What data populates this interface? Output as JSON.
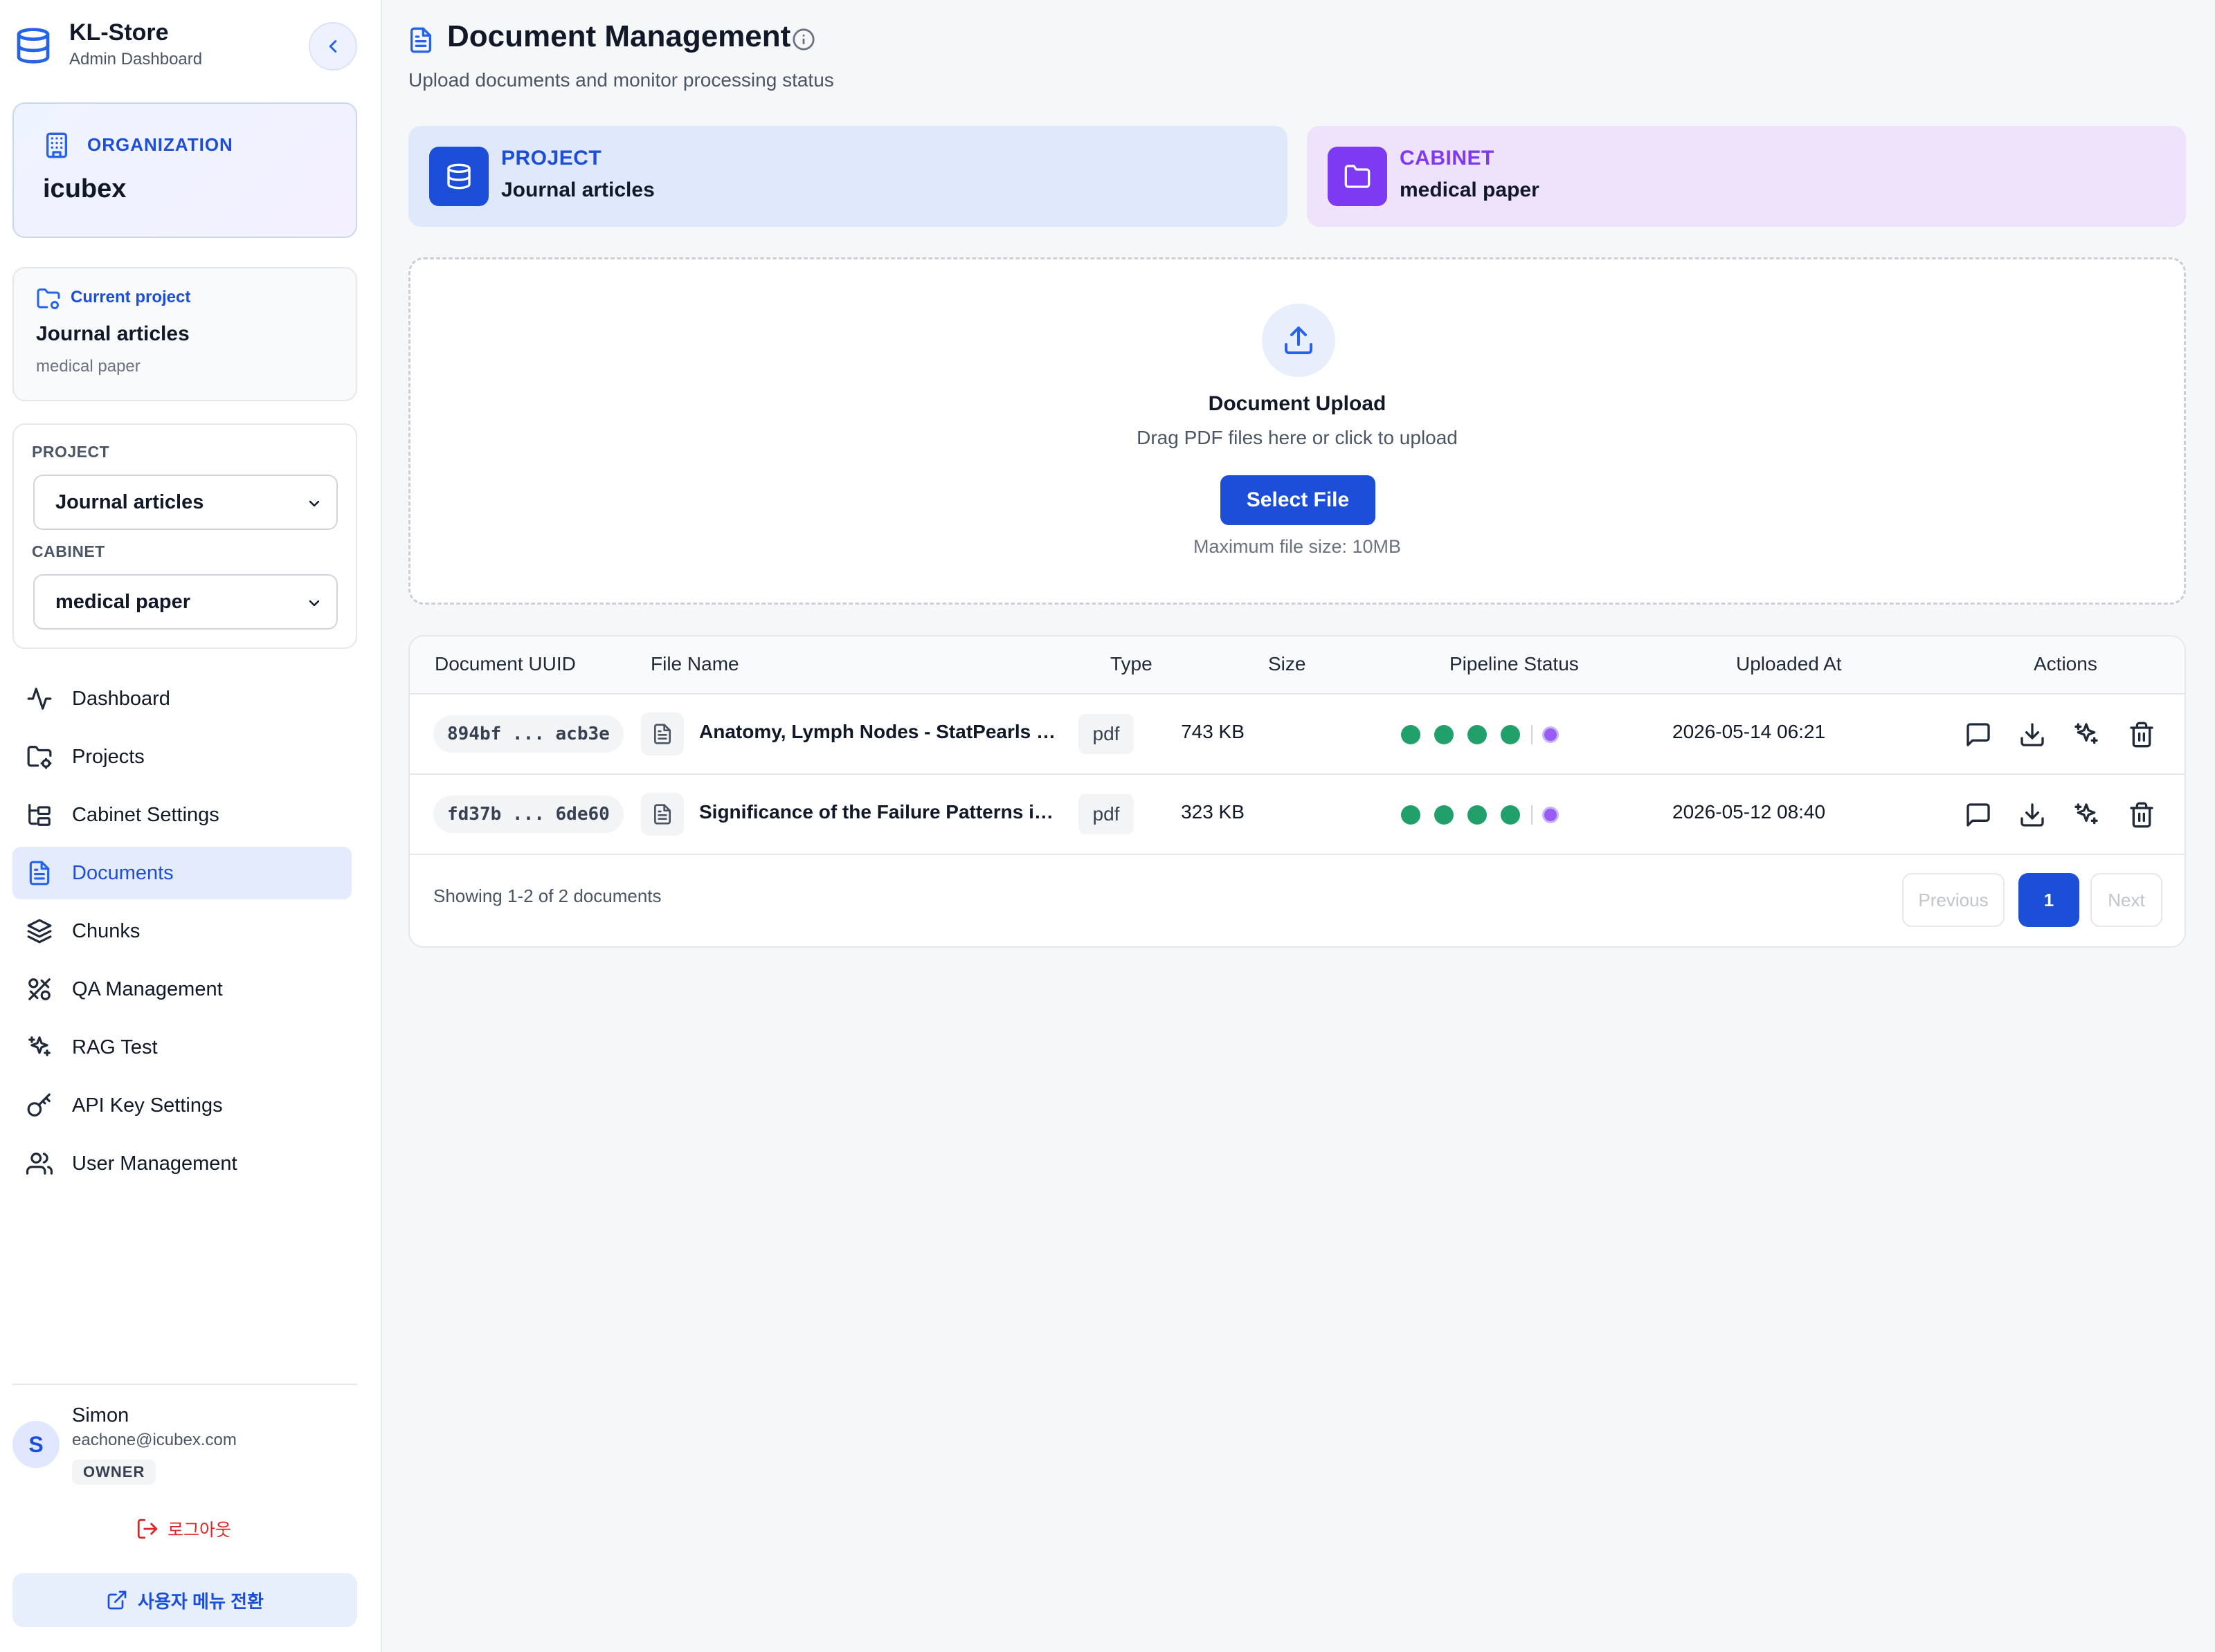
{
  "brand": {
    "name": "KL-Store",
    "subtitle": "Admin Dashboard"
  },
  "organization": {
    "label": "ORGANIZATION",
    "name": "icubex"
  },
  "current_project": {
    "label": "Current project",
    "name": "Journal articles",
    "cabinet": "medical paper"
  },
  "selectors": {
    "project_label": "PROJECT",
    "project_value": "Journal articles",
    "cabinet_label": "CABINET",
    "cabinet_value": "medical paper"
  },
  "nav": [
    {
      "label": "Dashboard",
      "icon": "activity-icon",
      "active": false
    },
    {
      "label": "Projects",
      "icon": "folder-settings-icon",
      "active": false
    },
    {
      "label": "Cabinet Settings",
      "icon": "folder-tree-icon",
      "active": false
    },
    {
      "label": "Documents",
      "icon": "file-text-icon",
      "active": true
    },
    {
      "label": "Chunks",
      "icon": "layers-icon",
      "active": false
    },
    {
      "label": "QA Management",
      "icon": "tools-icon",
      "active": false
    },
    {
      "label": "RAG Test",
      "icon": "sparkles-icon",
      "active": false
    },
    {
      "label": "API Key Settings",
      "icon": "key-icon",
      "active": false
    },
    {
      "label": "User Management",
      "icon": "users-icon",
      "active": false
    }
  ],
  "user": {
    "initial": "S",
    "name": "Simon",
    "email": "eachone@icubex.com",
    "role": "OWNER"
  },
  "logout_label": "로그아웃",
  "switch_menu_label": "사용자 메뉴 전환",
  "page": {
    "title": "Document Management",
    "subtitle": "Upload documents and monitor processing status"
  },
  "context": {
    "project_label": "PROJECT",
    "project_value": "Journal articles",
    "cabinet_label": "CABINET",
    "cabinet_value": "medical paper"
  },
  "upload": {
    "title": "Document Upload",
    "hint": "Drag PDF files here or click to upload",
    "button": "Select File",
    "max_size": "Maximum file size: 10MB"
  },
  "table": {
    "headers": {
      "uuid": "Document UUID",
      "file_name": "File Name",
      "type": "Type",
      "size": "Size",
      "pipeline": "Pipeline Status",
      "uploaded": "Uploaded At",
      "actions": "Actions"
    },
    "rows": [
      {
        "uuid": "894bf ... acb3e",
        "file_name": "Anatomy, Lymph Nodes - StatPearls - NCBI Bookshelf",
        "type": "pdf",
        "size": "743 KB",
        "pipeline_completed_steps": 4,
        "uploaded_at": "2026-05-14 06:21"
      },
      {
        "uuid": "fd37b ... 6de60",
        "file_name": "Significance of the Failure Patterns in Lymph Node Metastases",
        "type": "pdf",
        "size": "323 KB",
        "pipeline_completed_steps": 4,
        "uploaded_at": "2026-05-12 08:40"
      }
    ],
    "footer": "Showing 1-2 of 2 documents",
    "pagination": {
      "previous": "Previous",
      "current": "1",
      "next": "Next"
    }
  },
  "colors": {
    "primary": "#1d4ed8",
    "cabinet_accent": "#7e3af2",
    "status_complete": "#22a06b",
    "status_current": "#9b5cf6",
    "danger": "#dc2626"
  }
}
